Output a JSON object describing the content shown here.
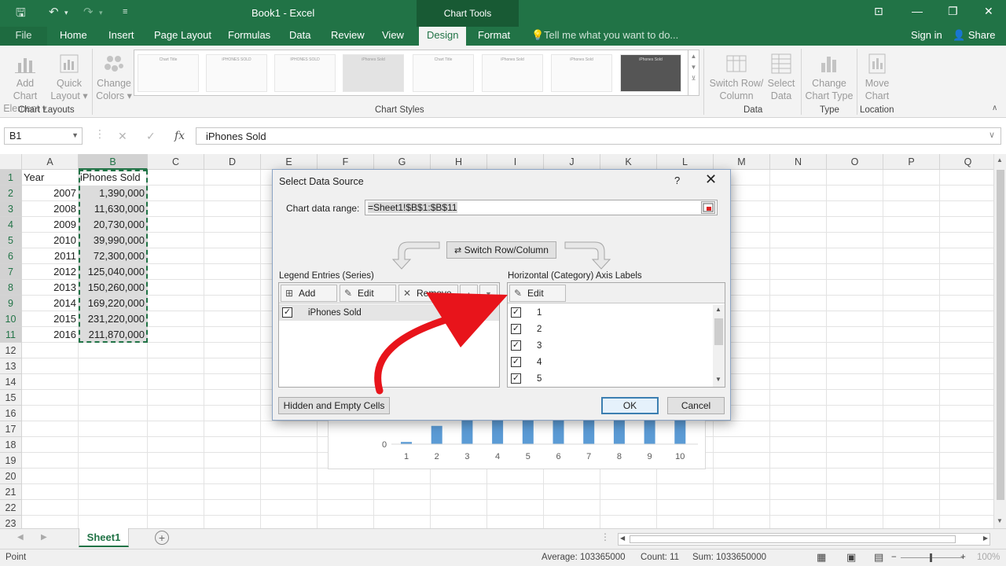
{
  "app": {
    "title": "Book1 - Excel",
    "context_tab": "Chart Tools",
    "sign_in": "Sign in",
    "share": "Share",
    "tell_me": "Tell me what you want to do..."
  },
  "tabs": [
    "File",
    "Home",
    "Insert",
    "Page Layout",
    "Formulas",
    "Data",
    "Review",
    "View",
    "Design",
    "Format"
  ],
  "ribbon": {
    "add_chart_element": [
      "Add Chart",
      "Element ▾"
    ],
    "quick_layout": [
      "Quick",
      "Layout ▾"
    ],
    "change_colors": [
      "Change",
      "Colors ▾"
    ],
    "switch_row_col": [
      "Switch Row/",
      "Column"
    ],
    "select_data": [
      "Select",
      "Data"
    ],
    "change_chart_type": [
      "Change",
      "Chart Type"
    ],
    "move_chart": [
      "Move",
      "Chart"
    ],
    "groups": {
      "chart_layouts": "Chart Layouts",
      "chart_styles": "Chart Styles",
      "data": "Data",
      "type": "Type",
      "location": "Location"
    },
    "thumb_titles": [
      "Chart Title",
      "iPHONES SOLD",
      "IPHONES SOLD",
      "iPhones Sold",
      "Chart Title",
      "iPhones Sold",
      "iPhones Sold",
      "iPhones Sold"
    ]
  },
  "formula_bar": {
    "name_box": "B1",
    "cancel": "✕",
    "enter": "✓",
    "fx": "fx",
    "content": "iPhones Sold"
  },
  "columns": [
    "A",
    "B",
    "C",
    "D",
    "E",
    "F",
    "G",
    "H",
    "I",
    "J",
    "K",
    "L",
    "M",
    "N",
    "O",
    "P",
    "Q"
  ],
  "rows": [
    "1",
    "2",
    "3",
    "4",
    "5",
    "6",
    "7",
    "8",
    "9",
    "10",
    "11",
    "12",
    "13",
    "14",
    "15",
    "16",
    "17",
    "18",
    "19",
    "20",
    "21",
    "22",
    "23"
  ],
  "cells": {
    "A1": "Year",
    "B1": "iPhones Sold",
    "years": [
      "2007",
      "2008",
      "2009",
      "2010",
      "2011",
      "2012",
      "2013",
      "2014",
      "2015",
      "2016"
    ],
    "sold": [
      "1,390,000",
      "11,630,000",
      "20,730,000",
      "39,990,000",
      "72,300,000",
      "125,040,000",
      "150,260,000",
      "169,220,000",
      "231,220,000",
      "211,870,000"
    ]
  },
  "chart_data": {
    "type": "bar",
    "categories": [
      "1",
      "2",
      "3",
      "4",
      "5",
      "6",
      "7",
      "8",
      "9",
      "10"
    ],
    "values": [
      1390000,
      11630000,
      20730000,
      39990000,
      72300000,
      125040000,
      150260000,
      169220000,
      231220000,
      211870000
    ],
    "y_tick_visible": "0",
    "bar_color": "#5b9bd5"
  },
  "sheet_tab": "Sheet1",
  "status": {
    "mode": "Point",
    "average": "Average: 103365000",
    "count": "Count: 11",
    "sum": "Sum: 1033650000",
    "zoom": "100%"
  },
  "dialog": {
    "title": "Select Data Source",
    "help": "?",
    "close": "✕",
    "range_label": "Chart data range:",
    "range_value": "=Sheet1!$B$1:$B$11",
    "switch": "Switch Row/Column",
    "legend_label": "Legend Entries (Series)",
    "axis_label": "Horizontal (Category) Axis Labels",
    "add": "Add",
    "edit": "Edit",
    "remove": "Remove",
    "series": [
      "iPhones Sold"
    ],
    "axis_items": [
      "1",
      "2",
      "3",
      "4",
      "5"
    ],
    "hidden_cells": "Hidden and Empty Cells",
    "ok": "OK",
    "cancel": "Cancel"
  },
  "colors": {
    "excel_green": "#217346",
    "annotation_arrow": "#e8141b",
    "chart_bar": "#5b9bd5"
  }
}
